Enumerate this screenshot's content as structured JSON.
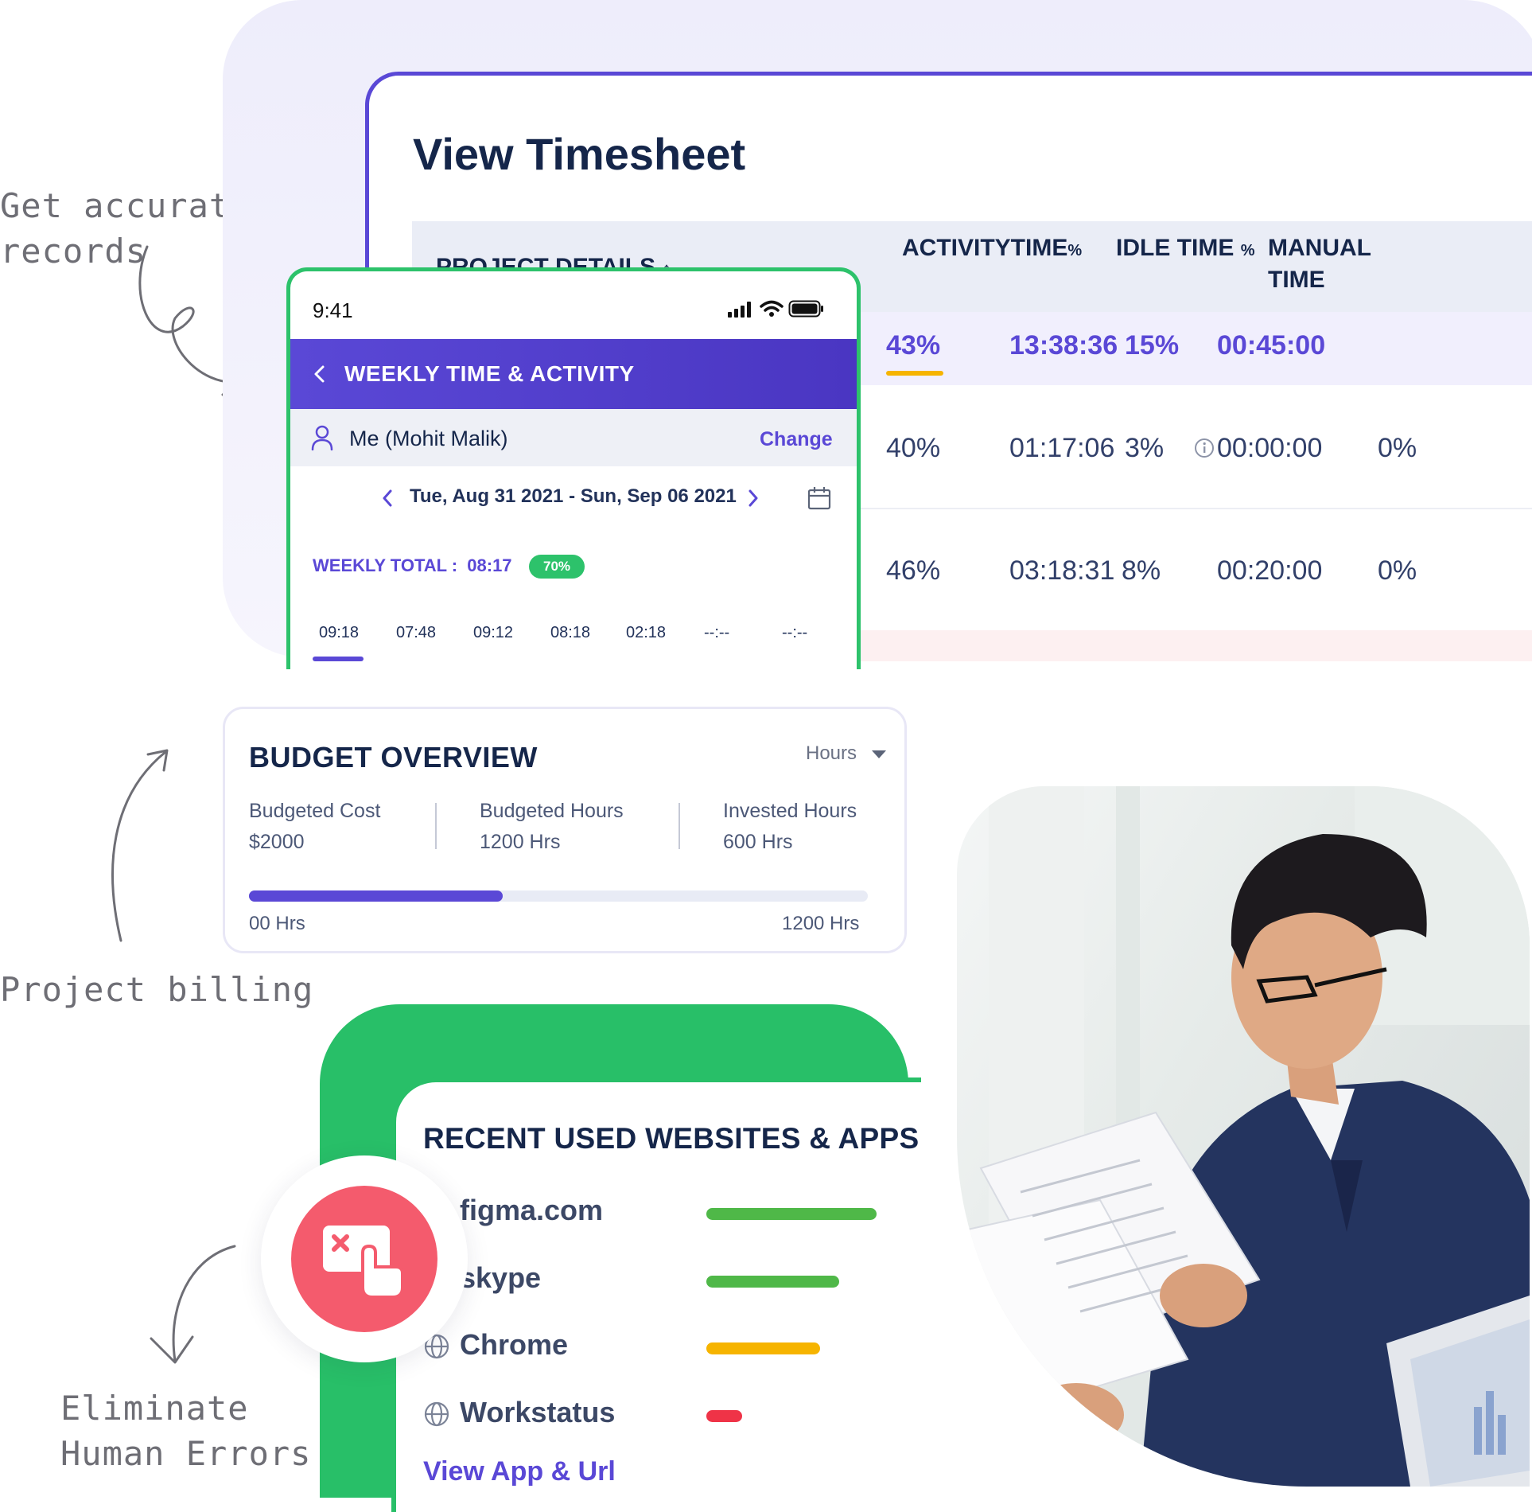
{
  "annotations": {
    "accurate_records": [
      "Get accurate",
      "records"
    ],
    "project_billing": "Project billing",
    "eliminate_errors": [
      "Eliminate",
      "Human Errors"
    ]
  },
  "timesheet": {
    "title": "View Timesheet",
    "headers": {
      "project_details": "PROJECT DETAILS",
      "activity_time": "ACTIVITYTIME",
      "idle_time": "IDLE TIME",
      "manual_time": [
        "MANUAL",
        "TIME"
      ],
      "percent_symbol": "%"
    },
    "rows": [
      {
        "activity_pct": "43%",
        "activity_time": "13:38:36",
        "idle_pct": "15%",
        "manual_time": "00:45:00",
        "manual_pct": ""
      },
      {
        "activity_pct": "40%",
        "activity_time": "01:17:06",
        "idle_pct": "3%",
        "manual_time": "00:00:00",
        "manual_pct": "0%"
      },
      {
        "activity_pct": "46%",
        "activity_time": "03:18:31",
        "idle_pct": "8%",
        "manual_time": "00:20:00",
        "manual_pct": "0%"
      }
    ]
  },
  "phone": {
    "status_time": "9:41",
    "header_title": "WEEKLY TIME & ACTIVITY",
    "user_name": "Me (Mohit Malik)",
    "change_link": "Change",
    "date_range": "Tue, Aug 31 2021 - Sun, Sep 06 2021",
    "weekly_total_label": "WEEKLY TOTAL :",
    "weekly_total_value": "08:17",
    "weekly_badge": "70%",
    "days": [
      "09:18",
      "07:48",
      "09:12",
      "08:18",
      "02:18",
      "--:--",
      "--:--"
    ]
  },
  "budget": {
    "title": "BUDGET OVERVIEW",
    "unit_select": "Hours",
    "metrics": [
      {
        "label": "Budgeted Cost",
        "value": "$2000"
      },
      {
        "label": "Budgeted Hours",
        "value": "1200 Hrs"
      },
      {
        "label": "Invested Hours",
        "value": "600 Hrs"
      }
    ],
    "progress_fraction": 0.41,
    "range_min": "00 Hrs",
    "range_max": "1200 Hrs"
  },
  "recent_apps": {
    "title": "RECENT USED WEBSITES & APPS",
    "items": [
      {
        "name": "figma.com",
        "fraction": 1.0,
        "color": "#4fb848"
      },
      {
        "name": "skype",
        "fraction": 0.78,
        "color": "#4fb848"
      },
      {
        "name": "Chrome",
        "fraction": 0.67,
        "color": "#f6b400"
      },
      {
        "name": "Workstatus",
        "fraction": 0.21,
        "color": "#ef3347"
      }
    ],
    "link": "View App & Url"
  },
  "colors": {
    "accent": "#5a48d6",
    "green": "#2dc26b",
    "error": "#f45b6d"
  }
}
